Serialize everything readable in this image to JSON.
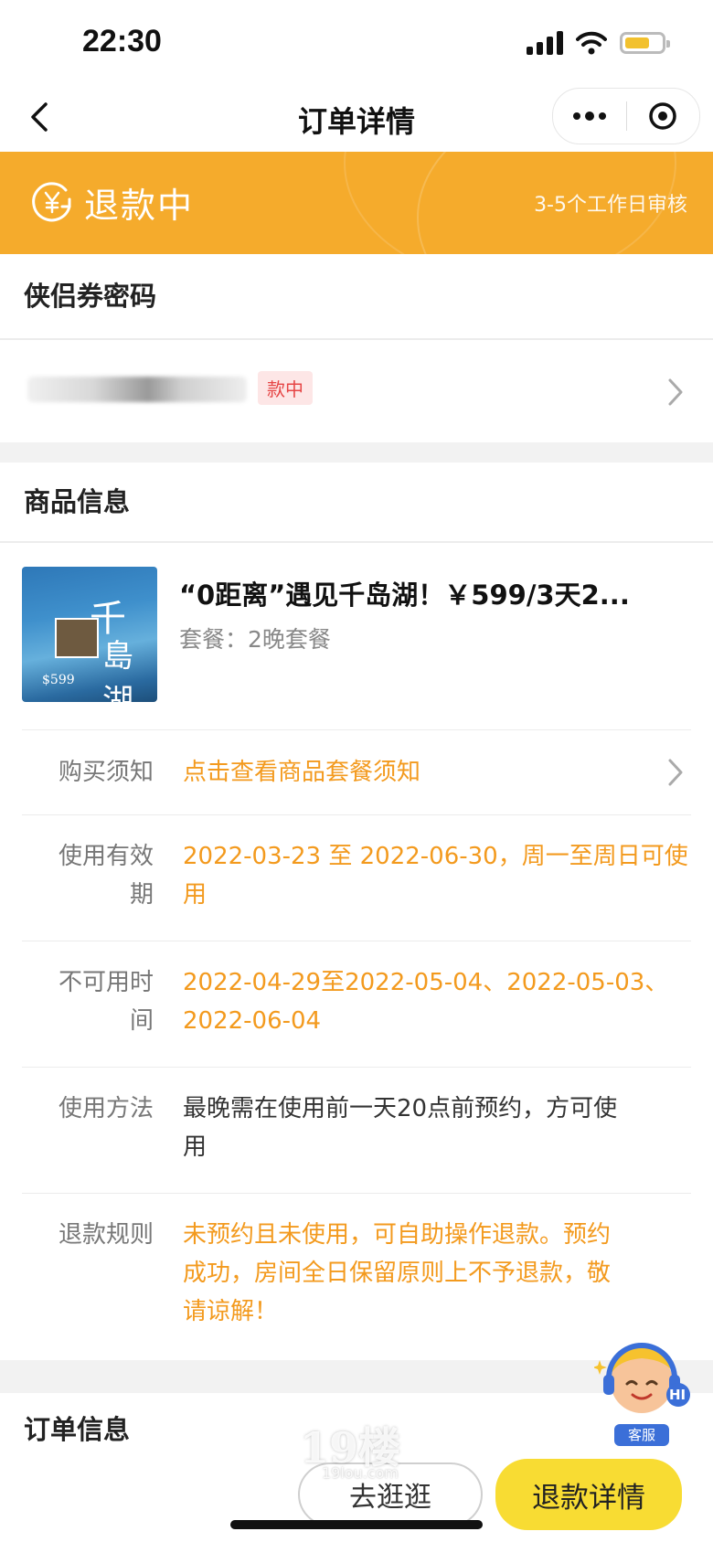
{
  "status_bar": {
    "time": "22:30"
  },
  "nav": {
    "title": "订单详情"
  },
  "banner": {
    "status": "退款中",
    "review_note": "3-5个工作日审核",
    "color": "#f5ab2c"
  },
  "coupon": {
    "title": "侠侣券密码",
    "status_tag": "款中"
  },
  "product": {
    "section_title": "商品信息",
    "name": "“0距离”遇见千岛湖！￥599/3天2...",
    "package": "套餐：2晚套餐",
    "thumb_text_1": "千",
    "thumb_text_2": "島湖",
    "thumb_price": "$599"
  },
  "details": [
    {
      "label": "购买须知",
      "value": "点击查看商品套餐须知"
    },
    {
      "label": "使用有效期",
      "value": "2022-03-23 至 2022-06-30，周一至周日可使用"
    },
    {
      "label": "不可用时间",
      "value": "2022-04-29至2022-05-04、2022-05-03、2022-06-04"
    },
    {
      "label": "使用方法",
      "value": "最晚需在使用前一天20点前预约，方可使用"
    },
    {
      "label": "退款规则",
      "value": "未预约且未使用，可自助操作退款。预约成功，房间全日保留原则上不予退款，敬请谅解！"
    }
  ],
  "order": {
    "section_title": "订单信息"
  },
  "buttons": {
    "browse": "去逛逛",
    "refund_detail": "退款详情"
  },
  "customer_service": {
    "label": "客服",
    "greeting": "HI"
  },
  "watermark": {
    "main": "19楼",
    "sub": "19lou.com"
  },
  "colors": {
    "accent_orange": "#f39a1e",
    "primary_button": "#f8dc33",
    "tag_red": "#e64545"
  }
}
